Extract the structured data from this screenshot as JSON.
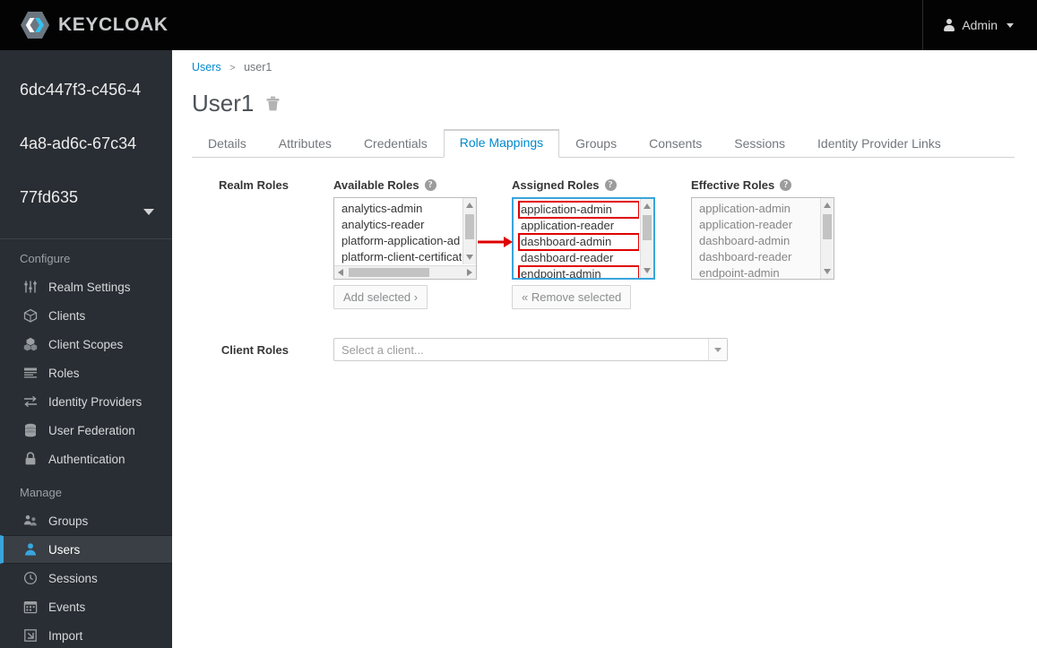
{
  "topbar": {
    "brand": "KEYCLOAK",
    "user_label": "Admin"
  },
  "sidebar": {
    "realm_name": "6dc447f3-c456-44a8-ad6c-67c3477fd635",
    "sections": [
      {
        "title": "Configure",
        "items": [
          {
            "label": "Realm Settings",
            "icon": "sliders-icon",
            "active": false
          },
          {
            "label": "Clients",
            "icon": "cube-icon",
            "active": false
          },
          {
            "label": "Client Scopes",
            "icon": "cubes-icon",
            "active": false
          },
          {
            "label": "Roles",
            "icon": "list-icon",
            "active": false
          },
          {
            "label": "Identity Providers",
            "icon": "exchange-icon",
            "active": false
          },
          {
            "label": "User Federation",
            "icon": "database-icon",
            "active": false
          },
          {
            "label": "Authentication",
            "icon": "lock-icon",
            "active": false
          }
        ]
      },
      {
        "title": "Manage",
        "items": [
          {
            "label": "Groups",
            "icon": "users-group-icon",
            "active": false
          },
          {
            "label": "Users",
            "icon": "user-icon",
            "active": true
          },
          {
            "label": "Sessions",
            "icon": "clock-icon",
            "active": false
          },
          {
            "label": "Events",
            "icon": "calendar-icon",
            "active": false
          },
          {
            "label": "Import",
            "icon": "import-icon",
            "active": false
          }
        ]
      }
    ]
  },
  "main": {
    "breadcrumb": {
      "root": "Users",
      "separator": ">",
      "current": "user1"
    },
    "page_title": "User1",
    "tabs": [
      {
        "label": "Details",
        "active": false
      },
      {
        "label": "Attributes",
        "active": false
      },
      {
        "label": "Credentials",
        "active": false
      },
      {
        "label": "Role Mappings",
        "active": true
      },
      {
        "label": "Groups",
        "active": false
      },
      {
        "label": "Consents",
        "active": false
      },
      {
        "label": "Sessions",
        "active": false
      },
      {
        "label": "Identity Provider Links",
        "active": false
      }
    ],
    "realm_roles": {
      "row_label": "Realm Roles",
      "available": {
        "heading": "Available Roles",
        "help": "?",
        "items": [
          "analytics-admin",
          "analytics-reader",
          "platform-application-ad",
          "platform-client-certificat"
        ],
        "button_label": "Add selected ›"
      },
      "assigned": {
        "heading": "Assigned Roles",
        "help": "?",
        "items": [
          {
            "label": "application-admin",
            "highlighted": true
          },
          {
            "label": "application-reader",
            "highlighted": false
          },
          {
            "label": "dashboard-admin",
            "highlighted": true
          },
          {
            "label": "dashboard-reader",
            "highlighted": false
          },
          {
            "label": "endpoint-admin",
            "highlighted": true
          }
        ],
        "button_label": "« Remove selected"
      },
      "effective": {
        "heading": "Effective Roles",
        "help": "?",
        "items": [
          "application-admin",
          "application-reader",
          "dashboard-admin",
          "dashboard-reader",
          "endpoint-admin"
        ]
      }
    },
    "client_roles": {
      "row_label": "Client Roles",
      "select_placeholder": "Select a client..."
    }
  },
  "colors": {
    "accent_blue": "#0088ce",
    "focus_blue": "#39a5dc",
    "annotation_red": "#e00000",
    "sidebar_bg": "#292e34",
    "topbar_bg": "#030303"
  }
}
